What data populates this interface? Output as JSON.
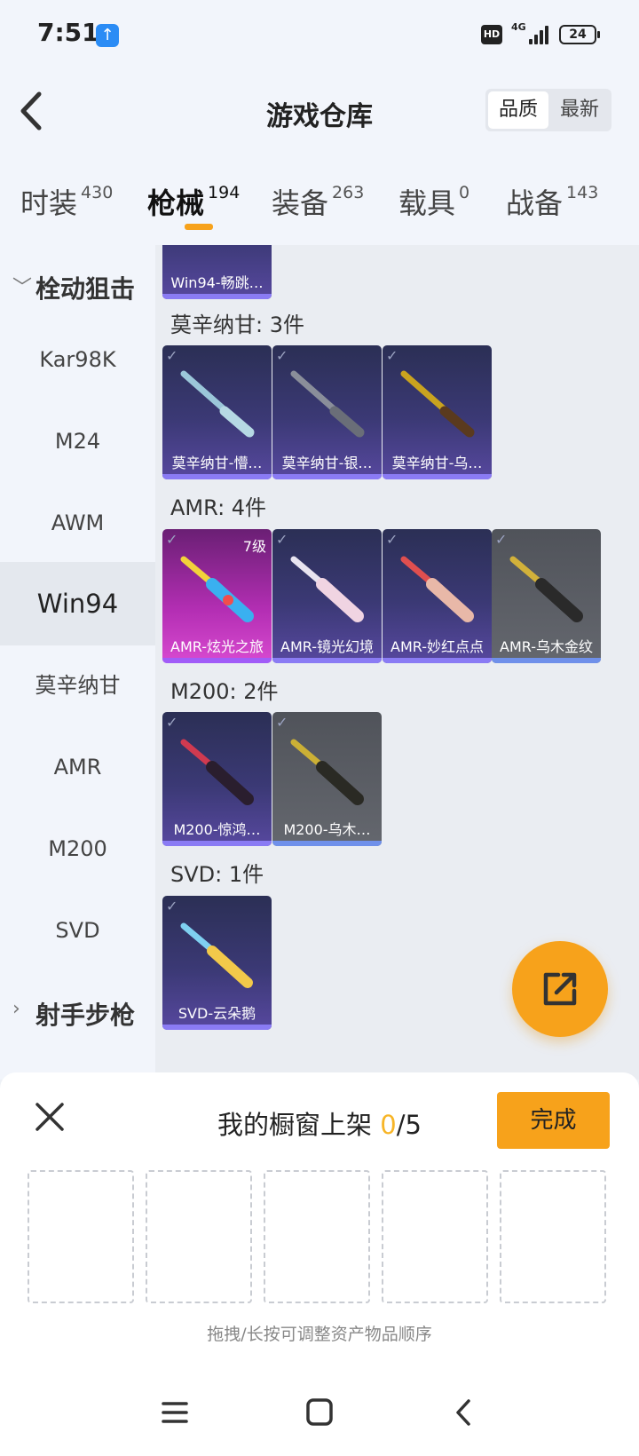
{
  "status": {
    "time": "7:51",
    "hd": "HD",
    "network": "4G",
    "battery": "24"
  },
  "header": {
    "title": "游戏仓库",
    "sort_options": [
      "品质",
      "最新"
    ]
  },
  "tabs": [
    {
      "label": "时装",
      "count": "430"
    },
    {
      "label": "枪械",
      "count": "194"
    },
    {
      "label": "装备",
      "count": "263"
    },
    {
      "label": "载具",
      "count": "0"
    },
    {
      "label": "战备",
      "count": "143"
    }
  ],
  "sidebar": {
    "group_expanded": "栓动狙击",
    "items": [
      "Kar98K",
      "M24",
      "AWM",
      "Win94",
      "莫辛纳甘",
      "AMR",
      "M200",
      "SVD"
    ],
    "group_collapsed": "射手步枪"
  },
  "content": {
    "partial_card": "Win94-畅跳…",
    "sections": [
      {
        "title": "莫辛纳甘: 3件",
        "items": [
          "莫辛纳甘-懵…",
          "莫辛纳甘-银…",
          "莫辛纳甘-乌…"
        ]
      },
      {
        "title": "AMR: 4件",
        "items": [
          "AMR-炫光之旅",
          "AMR-镜光幻境",
          "AMR-妙红点点",
          "AMR-乌木金纹"
        ],
        "level": "7级"
      },
      {
        "title": "M200: 2件",
        "items": [
          "M200-惊鸿…",
          "M200-乌木…"
        ]
      },
      {
        "title": "SVD: 1件",
        "items": [
          "SVD-云朵鹅"
        ]
      }
    ]
  },
  "panel": {
    "title": "我的橱窗上架 ",
    "count": "0",
    "total": "/5",
    "done": "完成",
    "hint": "拖拽/长按可调整资产物品顺序"
  }
}
